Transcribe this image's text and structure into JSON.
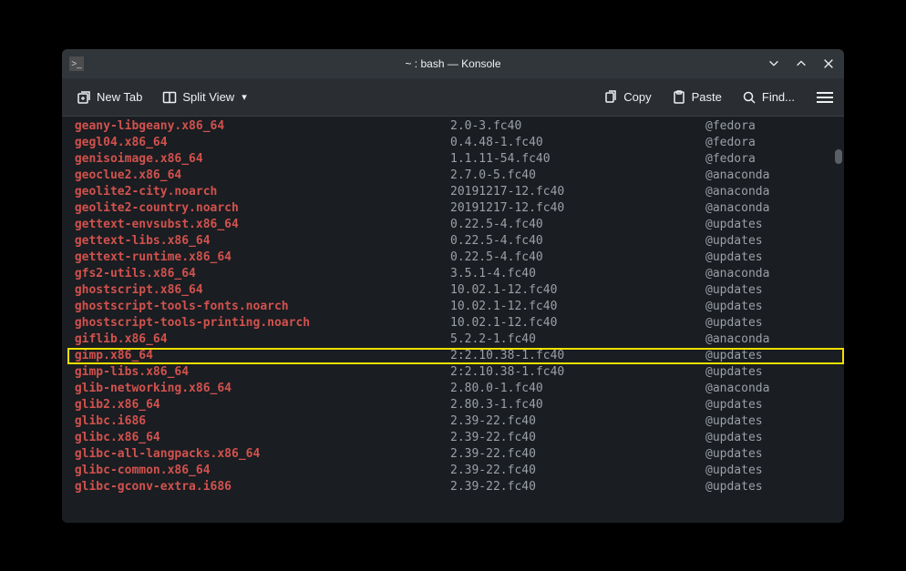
{
  "titlebar": {
    "icon_glyph": ">_",
    "title": "~ : bash — Konsole"
  },
  "toolbar": {
    "new_tab": "New Tab",
    "split_view": "Split View",
    "copy": "Copy",
    "paste": "Paste",
    "find": "Find..."
  },
  "packages": [
    {
      "name": "geany-libgeany.x86_64",
      "version": "2.0-3.fc40",
      "repo": "@fedora",
      "highlighted": false
    },
    {
      "name": "gegl04.x86_64",
      "version": "0.4.48-1.fc40",
      "repo": "@fedora",
      "highlighted": false
    },
    {
      "name": "genisoimage.x86_64",
      "version": "1.1.11-54.fc40",
      "repo": "@fedora",
      "highlighted": false
    },
    {
      "name": "geoclue2.x86_64",
      "version": "2.7.0-5.fc40",
      "repo": "@anaconda",
      "highlighted": false
    },
    {
      "name": "geolite2-city.noarch",
      "version": "20191217-12.fc40",
      "repo": "@anaconda",
      "highlighted": false
    },
    {
      "name": "geolite2-country.noarch",
      "version": "20191217-12.fc40",
      "repo": "@anaconda",
      "highlighted": false
    },
    {
      "name": "gettext-envsubst.x86_64",
      "version": "0.22.5-4.fc40",
      "repo": "@updates",
      "highlighted": false
    },
    {
      "name": "gettext-libs.x86_64",
      "version": "0.22.5-4.fc40",
      "repo": "@updates",
      "highlighted": false
    },
    {
      "name": "gettext-runtime.x86_64",
      "version": "0.22.5-4.fc40",
      "repo": "@updates",
      "highlighted": false
    },
    {
      "name": "gfs2-utils.x86_64",
      "version": "3.5.1-4.fc40",
      "repo": "@anaconda",
      "highlighted": false
    },
    {
      "name": "ghostscript.x86_64",
      "version": "10.02.1-12.fc40",
      "repo": "@updates",
      "highlighted": false
    },
    {
      "name": "ghostscript-tools-fonts.noarch",
      "version": "10.02.1-12.fc40",
      "repo": "@updates",
      "highlighted": false
    },
    {
      "name": "ghostscript-tools-printing.noarch",
      "version": "10.02.1-12.fc40",
      "repo": "@updates",
      "highlighted": false
    },
    {
      "name": "giflib.x86_64",
      "version": "5.2.2-1.fc40",
      "repo": "@anaconda",
      "highlighted": false
    },
    {
      "name": "gimp.x86_64",
      "version": "2:2.10.38-1.fc40",
      "repo": "@updates",
      "highlighted": true
    },
    {
      "name": "gimp-libs.x86_64",
      "version": "2:2.10.38-1.fc40",
      "repo": "@updates",
      "highlighted": false
    },
    {
      "name": "glib-networking.x86_64",
      "version": "2.80.0-1.fc40",
      "repo": "@anaconda",
      "highlighted": false
    },
    {
      "name": "glib2.x86_64",
      "version": "2.80.3-1.fc40",
      "repo": "@updates",
      "highlighted": false
    },
    {
      "name": "glibc.i686",
      "version": "2.39-22.fc40",
      "repo": "@updates",
      "highlighted": false
    },
    {
      "name": "glibc.x86_64",
      "version": "2.39-22.fc40",
      "repo": "@updates",
      "highlighted": false
    },
    {
      "name": "glibc-all-langpacks.x86_64",
      "version": "2.39-22.fc40",
      "repo": "@updates",
      "highlighted": false
    },
    {
      "name": "glibc-common.x86_64",
      "version": "2.39-22.fc40",
      "repo": "@updates",
      "highlighted": false
    },
    {
      "name": "glibc-gconv-extra.i686",
      "version": "2.39-22.fc40",
      "repo": "@updates",
      "highlighted": false
    }
  ]
}
